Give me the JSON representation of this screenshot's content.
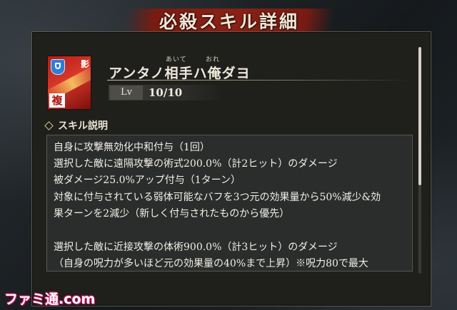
{
  "dialog": {
    "title": "必殺スキル詳細"
  },
  "skill": {
    "icon_name": "skill-slash-icon",
    "icon_corner_text": "影",
    "icon_badge": "複",
    "ruby_aite": "あいて",
    "ruby_ore": "おれ",
    "name": "アンタノ相手ハ俺ダヨ",
    "level_label": "Lv",
    "level_value": "10/10"
  },
  "description": {
    "section_label": "スキル説明",
    "lines": [
      "自身に攻撃無効化中和付与（1回）",
      "選択した敵に遠隔攻撃の術式200.0%（計2ヒット）のダメージ",
      "被ダメージ25.0%アップ付与（1ターン）",
      "対象に付与されている弱体可能なバフを3つ元の効果量から50%減少&効",
      "果ターンを2減少（新しく付与されたものから優先）",
      "",
      "選択した敵に近接攻撃の体術900.0%（計3ヒット）のダメージ",
      "（自身の呪力が多いほど元の効果量の40%まで上昇）※呪力80で最大"
    ]
  },
  "watermark": "ファミ通.com",
  "colors": {
    "banner": "#8a2116",
    "accent_gold": "#d7c98f",
    "panel_bg": "#1f1f1c",
    "text_box_bg": "#2a2d2c"
  }
}
